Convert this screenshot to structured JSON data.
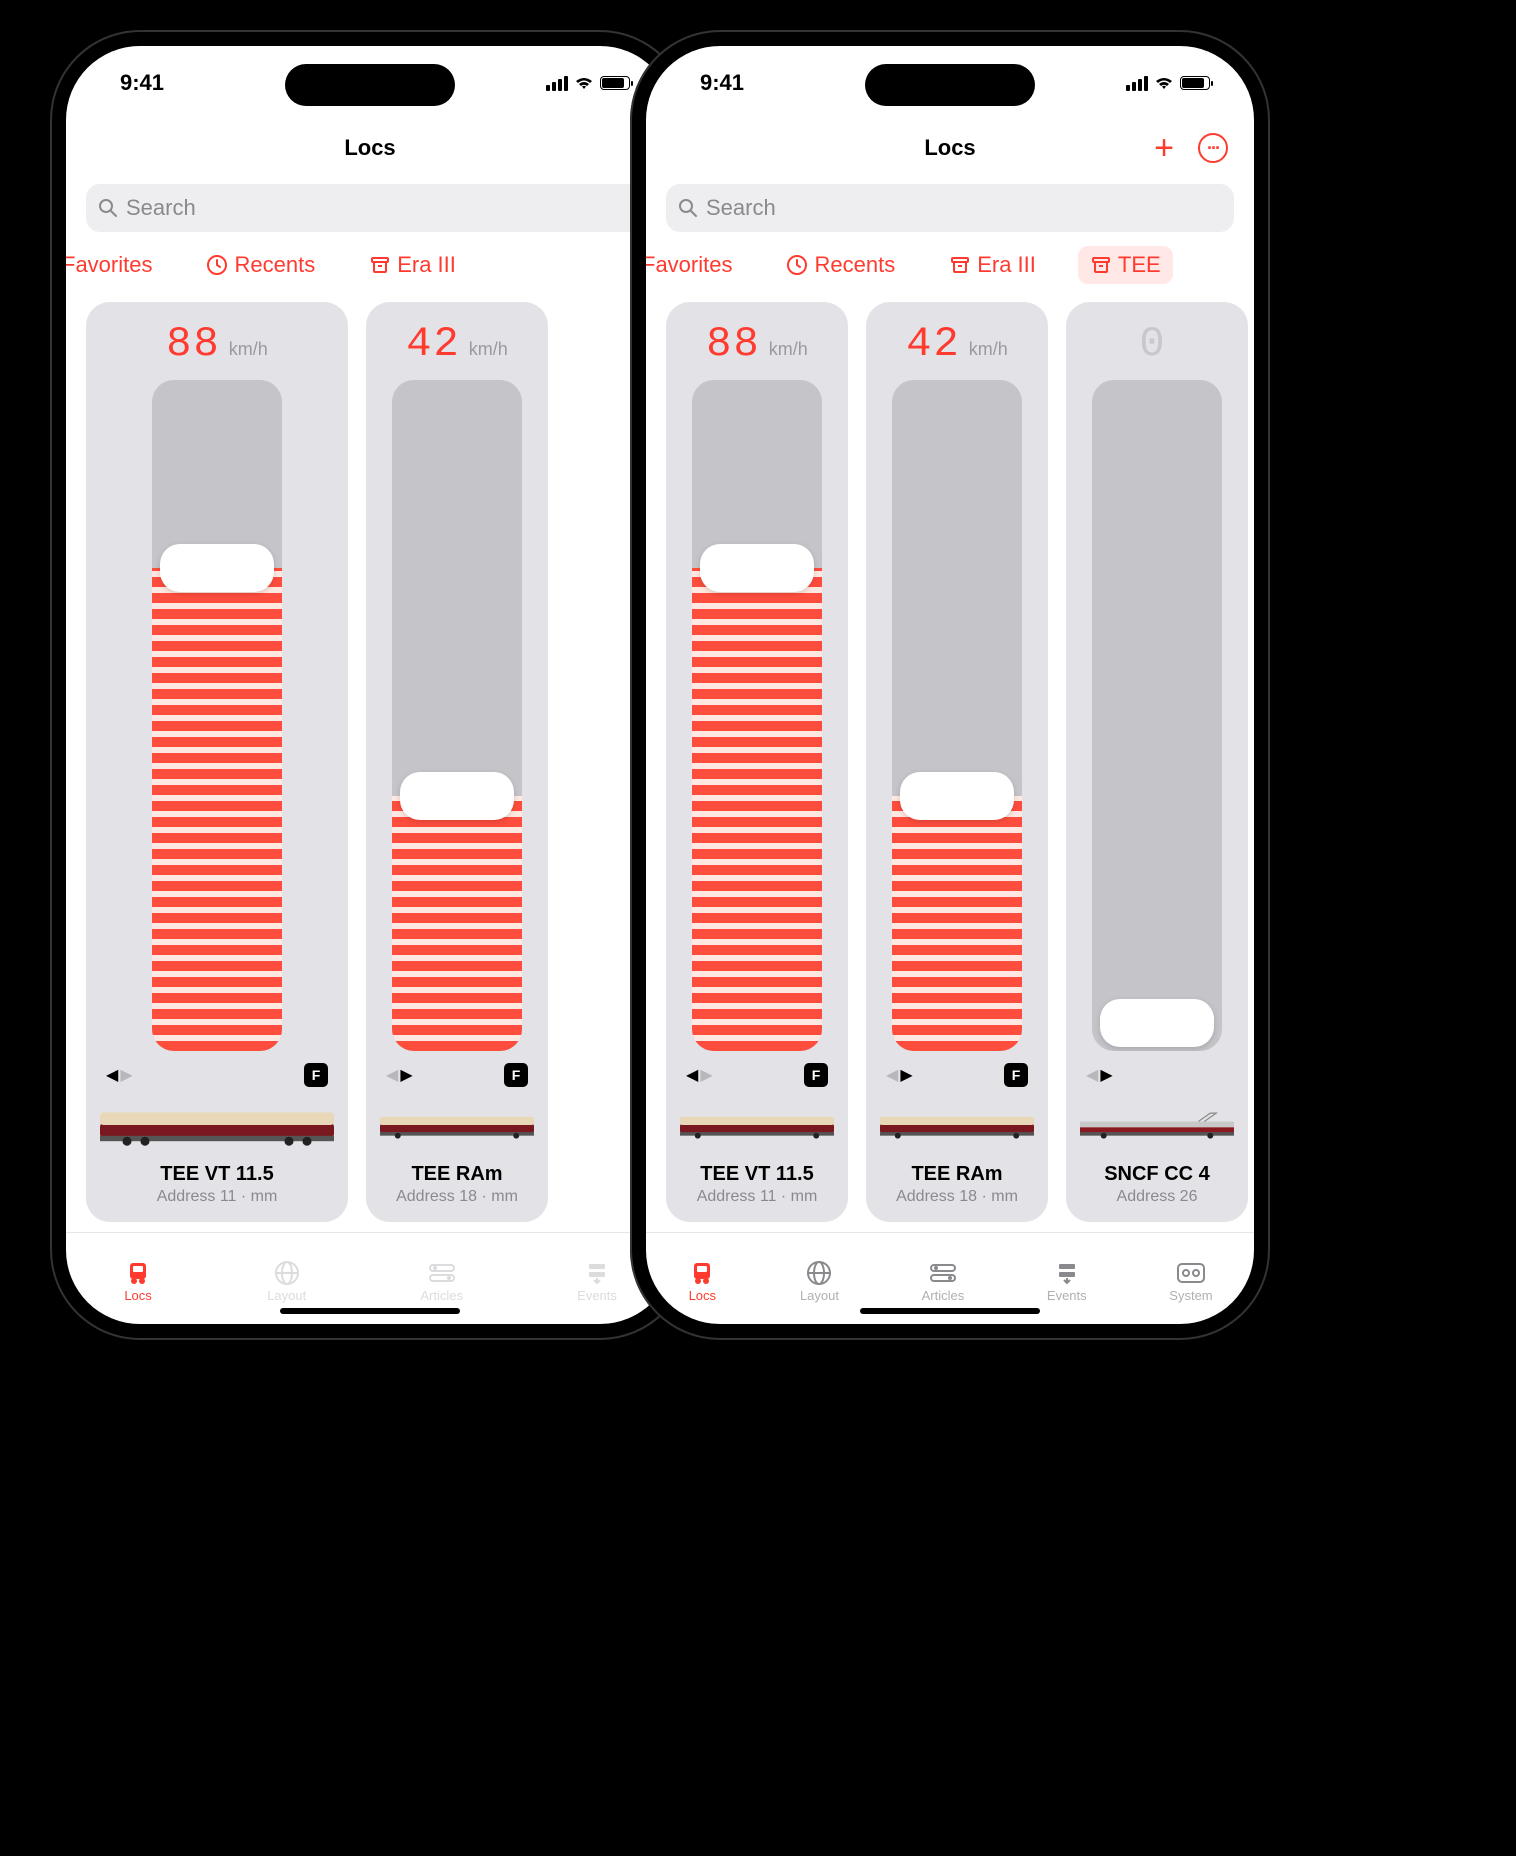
{
  "status": {
    "time": "9:41"
  },
  "nav": {
    "title": "Locs",
    "plus": "+",
    "more": "···"
  },
  "search": {
    "placeholder": "Search"
  },
  "filters": {
    "favorites": "Favorites",
    "recents": "Recents",
    "era3": "Era III",
    "tee": "TEE"
  },
  "locos": [
    {
      "speed": "88",
      "unit": "km/h",
      "fill_pct": 72,
      "dir": "left",
      "f": "F",
      "name": "TEE VT 11.5",
      "sub": "Address 11 · mm"
    },
    {
      "speed": "42",
      "unit": "km/h",
      "fill_pct": 38,
      "dir": "right",
      "f": "F",
      "name": "TEE RAm",
      "sub": "Address 18 · mm"
    },
    {
      "speed": "0",
      "unit": "",
      "fill_pct": 0,
      "dir": "right",
      "f": "",
      "name": "SNCF CC 4",
      "sub": "Address 26"
    }
  ],
  "tabs": {
    "locs": "Locs",
    "layout": "Layout",
    "articles": "Articles",
    "events": "Events",
    "system": "System"
  },
  "colors": {
    "accent": "#ff3b30"
  }
}
